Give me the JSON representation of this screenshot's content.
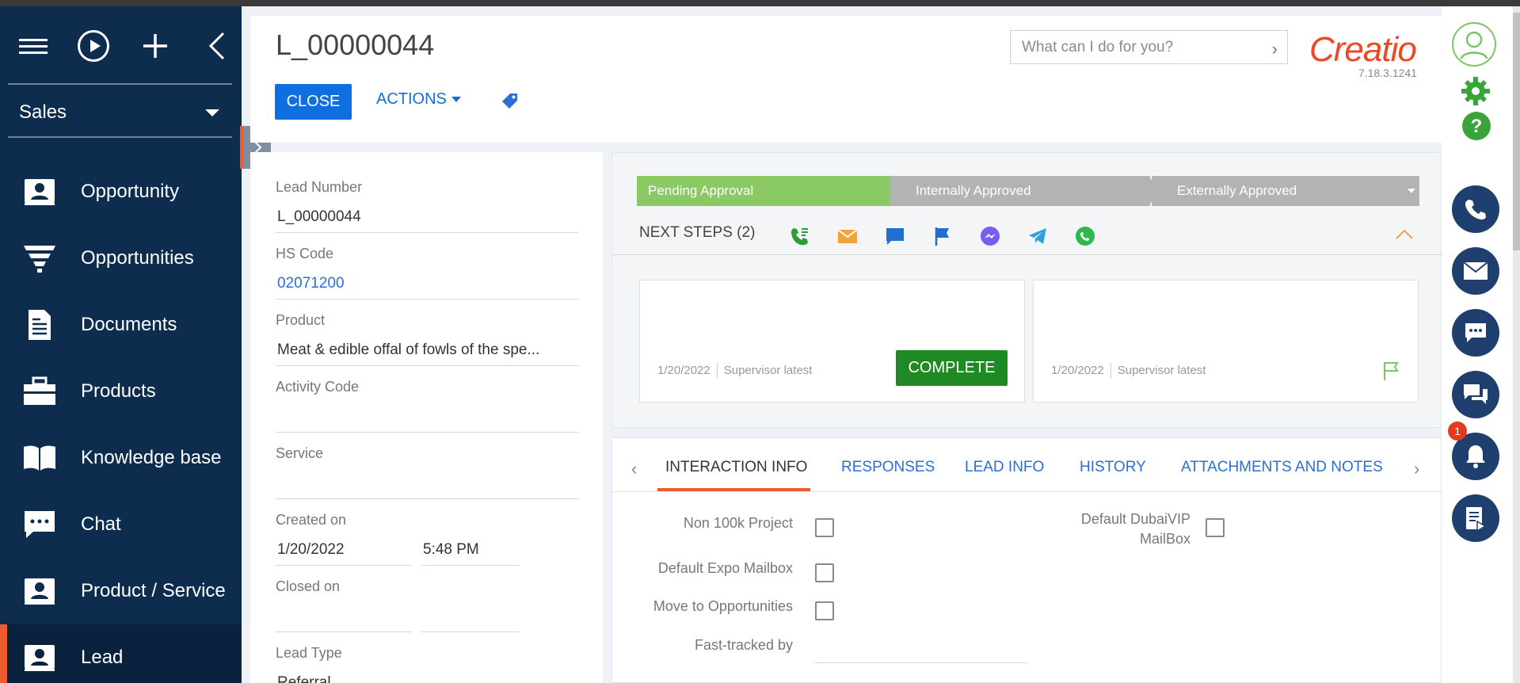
{
  "sidebar": {
    "section": "Sales",
    "items": [
      {
        "label": "Opportunity",
        "icon": "contact-card-icon"
      },
      {
        "label": "Opportunities",
        "icon": "funnel-icon"
      },
      {
        "label": "Documents",
        "icon": "document-icon"
      },
      {
        "label": "Products",
        "icon": "briefcase-icon"
      },
      {
        "label": "Knowledge base",
        "icon": "book-icon"
      },
      {
        "label": "Chat",
        "icon": "chat-bubble-icon"
      },
      {
        "label": "Product / Service",
        "icon": "contact-card-icon"
      },
      {
        "label": "Lead",
        "icon": "contact-card-icon"
      }
    ]
  },
  "header": {
    "title": "L_00000044",
    "close_label": "CLOSE",
    "actions_label": "ACTIONS",
    "search_placeholder": "What can I do for you?",
    "logo_text": "Creatio",
    "version": "7.18.3.1241"
  },
  "form": {
    "lead_number_label": "Lead Number",
    "lead_number_value": "L_00000044",
    "hs_code_label": "HS Code",
    "hs_code_value": "02071200",
    "product_label": "Product",
    "product_value": "Meat & edible offal of fowls of the spe...",
    "activity_code_label": "Activity Code",
    "service_label": "Service",
    "created_on_label": "Created on",
    "created_on_date": "1/20/2022",
    "created_on_time": "5:48 PM",
    "closed_on_label": "Closed on",
    "lead_type_label": "Lead Type",
    "lead_type_value": "Referral"
  },
  "stages": [
    {
      "label": "Pending Approval",
      "status": "active",
      "color": "#8bc965"
    },
    {
      "label": "Internally Approved",
      "status": "inactive",
      "color": "#b3b3b3"
    },
    {
      "label": "Externally Approved",
      "status": "inactive",
      "color": "#b3b3b3"
    }
  ],
  "next_steps": {
    "title": "NEXT STEPS (2)",
    "icons": [
      "phone-call-icon",
      "email-icon",
      "message-icon",
      "flag-icon",
      "messenger-icon",
      "telegram-icon",
      "whatsapp-icon"
    ],
    "cards": [
      {
        "date": "1/20/2022",
        "owner": "Supervisor latest",
        "action_label": "COMPLETE"
      },
      {
        "date": "1/20/2022",
        "owner": "Supervisor latest"
      }
    ]
  },
  "tabs": {
    "items": [
      "INTERACTION INFO",
      "RESPONSES",
      "LEAD INFO",
      "HISTORY",
      "ATTACHMENTS AND NOTES"
    ],
    "active": "INTERACTION INFO"
  },
  "interaction": {
    "non_100k_project": "Non 100k Project",
    "default_expo_mailbox": "Default Expo Mailbox",
    "move_to_opportunities": "Move to Opportunities",
    "fast_tracked_by": "Fast-tracked by",
    "default_dubaivip_mailbox_line1": "Default DubaiVIP",
    "default_dubaivip_mailbox_line2": "MailBox"
  },
  "notifications": {
    "count": "1"
  },
  "colors": {
    "sidebar_bg": "#0e2c4e",
    "accent": "#ef5b2f",
    "primary_button": "#0f6fde",
    "stage_active": "#8bc965",
    "complete_button": "#1e8a23"
  }
}
